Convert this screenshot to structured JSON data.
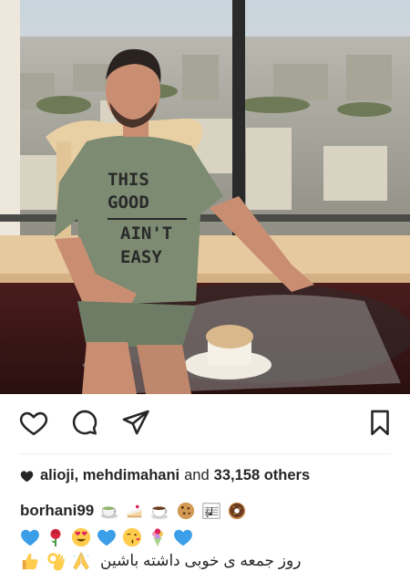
{
  "post": {
    "photo_alt": "",
    "shirt_text": [
      "THIS",
      "GOOD",
      "AIN'T",
      "EASY"
    ]
  },
  "actions": {
    "like_icon": "heart-outline-icon",
    "comment_icon": "comment-bubble-icon",
    "share_icon": "paper-plane-icon",
    "save_icon": "bookmark-icon"
  },
  "likes": {
    "icon": "heart-filled-icon",
    "users": "alioji, mehdimahani",
    "connector": "and",
    "others": "33,158 others"
  },
  "caption": {
    "username": "borhani99",
    "line1_emojis": [
      "tea-cup",
      "cake-slice",
      "coffee-cup",
      "cookie",
      "music-sheet",
      "donut"
    ],
    "line2_emojis": [
      "blue-heart",
      "red-rose",
      "heart-eyes-face",
      "blue-heart",
      "kissing-face",
      "bouquet",
      "blue-heart"
    ],
    "line3_emojis": [
      "thumbs-up",
      "ok-hand",
      "folded-hands"
    ],
    "text": "روز جمعه ی خوبی داشته باشین"
  },
  "colors": {
    "text": "#262626",
    "divider": "#efefef",
    "blue_heart": "#3a9ee8",
    "red": "#e0245e"
  }
}
